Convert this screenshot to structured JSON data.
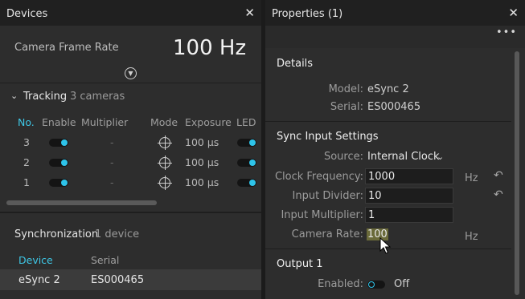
{
  "devices_panel": {
    "title": "Devices",
    "close": "✕",
    "frame_rate_label": "Camera Frame Rate",
    "frame_rate_value": "100 Hz",
    "tracking": {
      "label": "Tracking",
      "sub": "3 cameras",
      "columns": [
        "No.",
        "Enable",
        "Multiplier",
        "Mode",
        "Exposure",
        "LED"
      ],
      "rows": [
        {
          "no": "3",
          "multiplier": "-",
          "exposure": "100 µs"
        },
        {
          "no": "2",
          "multiplier": "-",
          "exposure": "100 µs"
        },
        {
          "no": "1",
          "multiplier": "-",
          "exposure": "100 µs"
        }
      ]
    },
    "synchronization": {
      "label": "Synchronization",
      "sub": "1 device",
      "columns": [
        "Device",
        "Serial"
      ],
      "rows": [
        {
          "device": "eSync 2",
          "serial": "ES000465"
        }
      ]
    }
  },
  "properties_panel": {
    "title": "Properties (1)",
    "close": "✕",
    "more": "•••",
    "details": {
      "header": "Details",
      "model_label": "Model:",
      "model_value": "eSync 2",
      "serial_label": "Serial:",
      "serial_value": "ES000465"
    },
    "sync_input": {
      "header": "Sync Input Settings",
      "source_label": "Source:",
      "source_value": "Internal Clock",
      "clock_freq_label": "Clock Frequency:",
      "clock_freq_value": "1000",
      "clock_freq_unit": "Hz",
      "input_divider_label": "Input Divider:",
      "input_divider_value": "10",
      "input_multiplier_label": "Input Multiplier:",
      "input_multiplier_value": "1",
      "camera_rate_label": "Camera Rate:",
      "camera_rate_value": "100",
      "camera_rate_unit": "Hz"
    },
    "output1": {
      "header": "Output 1",
      "enabled_label": "Enabled:",
      "enabled_value": "Off"
    }
  },
  "colors": {
    "accent": "#2ec4ea",
    "panel_bg": "#2d2d2d",
    "title_bg": "#202020"
  }
}
